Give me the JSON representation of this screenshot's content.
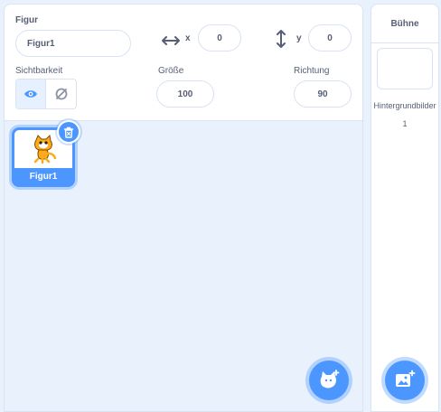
{
  "sprite_info": {
    "section_title": "Figur",
    "name_value": "Figur1",
    "x_label": "x",
    "x_value": "0",
    "y_label": "y",
    "y_value": "0",
    "visibility_label": "Sichtbarkeit",
    "size_label": "Größe",
    "size_value": "100",
    "direction_label": "Richtung",
    "direction_value": "90"
  },
  "sprite_list": {
    "items": [
      {
        "label": "Figur1",
        "selected": true
      }
    ]
  },
  "stage": {
    "title": "Bühne",
    "backdrops_label": "Hintergrundbilder",
    "backdrops_count": "1"
  },
  "colors": {
    "accent": "#4c97ff",
    "text": "#575e75",
    "panel_bg": "#e9f1fc",
    "border": "#d9e3f2"
  },
  "icons": [
    "horizontal-arrows-icon",
    "vertical-arrows-icon",
    "eye-icon",
    "eye-slash-icon",
    "trash-icon",
    "cat-icon",
    "add-sprite-icon",
    "add-backdrop-icon"
  ]
}
